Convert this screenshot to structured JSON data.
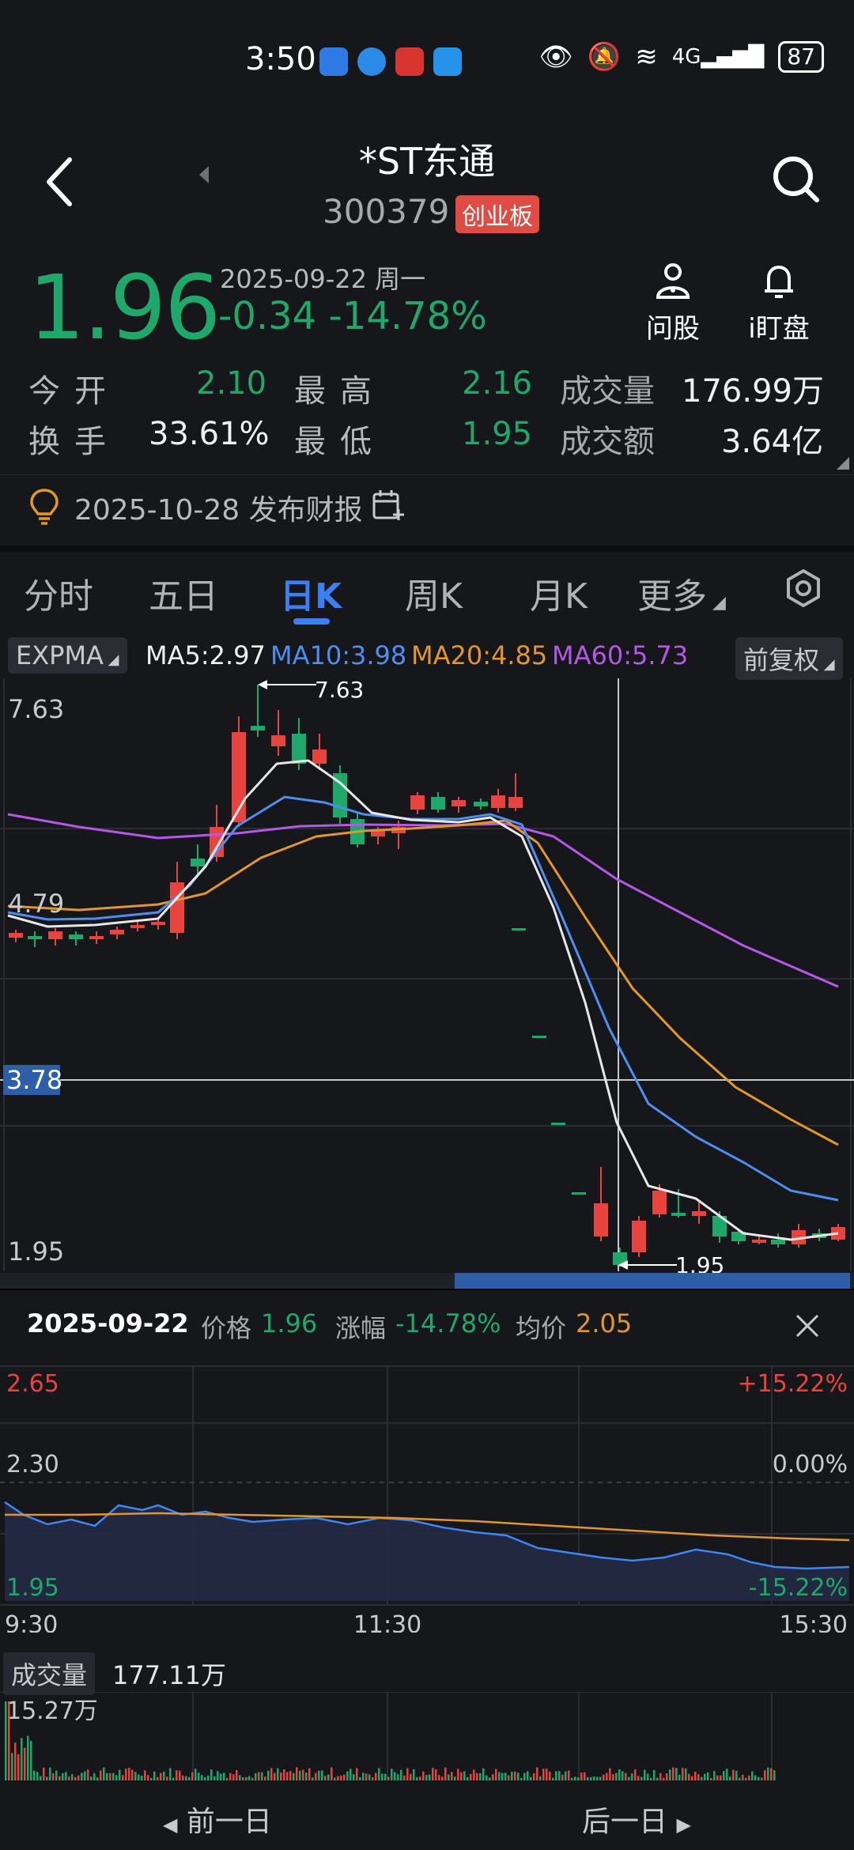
{
  "status": {
    "time": "3:50",
    "battery": "87"
  },
  "header": {
    "title": "*ST东通",
    "code": "300379",
    "board": "创业板"
  },
  "quote": {
    "price": "1.96",
    "date": "2025-09-22 周一",
    "change": "-0.34",
    "change_pct": "-14.78%",
    "open_label": "今开",
    "open": "2.10",
    "high_label": "最高",
    "high": "2.16",
    "vol_label": "成交量",
    "vol": "176.99万",
    "turn_label": "换手",
    "turn": "33.61%",
    "low_label": "最低",
    "low": "1.95",
    "amt_label": "成交额",
    "amt": "3.64亿"
  },
  "actions": {
    "ask": "问股",
    "watch": "i盯盘"
  },
  "financial_notice": "2025-10-28 发布财报",
  "tabs": [
    "分时",
    "五日",
    "日K",
    "周K",
    "月K",
    "更多"
  ],
  "indicator": {
    "name": "EXPMA",
    "ma5": "MA5:2.97",
    "ma10": "MA10:3.98",
    "ma20": "MA20:4.85",
    "ma60": "MA60:5.73",
    "adjust": "前复权"
  },
  "kline_axis": {
    "top": "7.63",
    "mid": "4.79",
    "cross": "3.78",
    "bottom": "1.95",
    "high_mark": "7.63",
    "low_mark": "1.95"
  },
  "info": {
    "date": "2025-09-22",
    "price_label": "价格",
    "price": "1.96",
    "chg_label": "涨幅",
    "chg": "-14.78%",
    "avg_label": "均价",
    "avg": "2.05"
  },
  "intraday_axis": {
    "top": "2.65",
    "mid": "2.30",
    "bottom": "1.95",
    "top_pct": "+15.22%",
    "mid_pct": "0.00%",
    "bottom_pct": "-15.22%",
    "t_start": "9:30",
    "t_mid": "11:30",
    "t_end": "15:30"
  },
  "volume": {
    "label": "成交量",
    "value": "177.11万",
    "max": "15.27万"
  },
  "nav": {
    "prev": "前一日",
    "next": "后一日"
  },
  "colors": {
    "up": "#e8443d",
    "down": "#1ea96b",
    "ma5": "#e8e8e8",
    "ma10": "#4f8df0",
    "ma20": "#e3962a",
    "ma60": "#b558e6"
  }
}
